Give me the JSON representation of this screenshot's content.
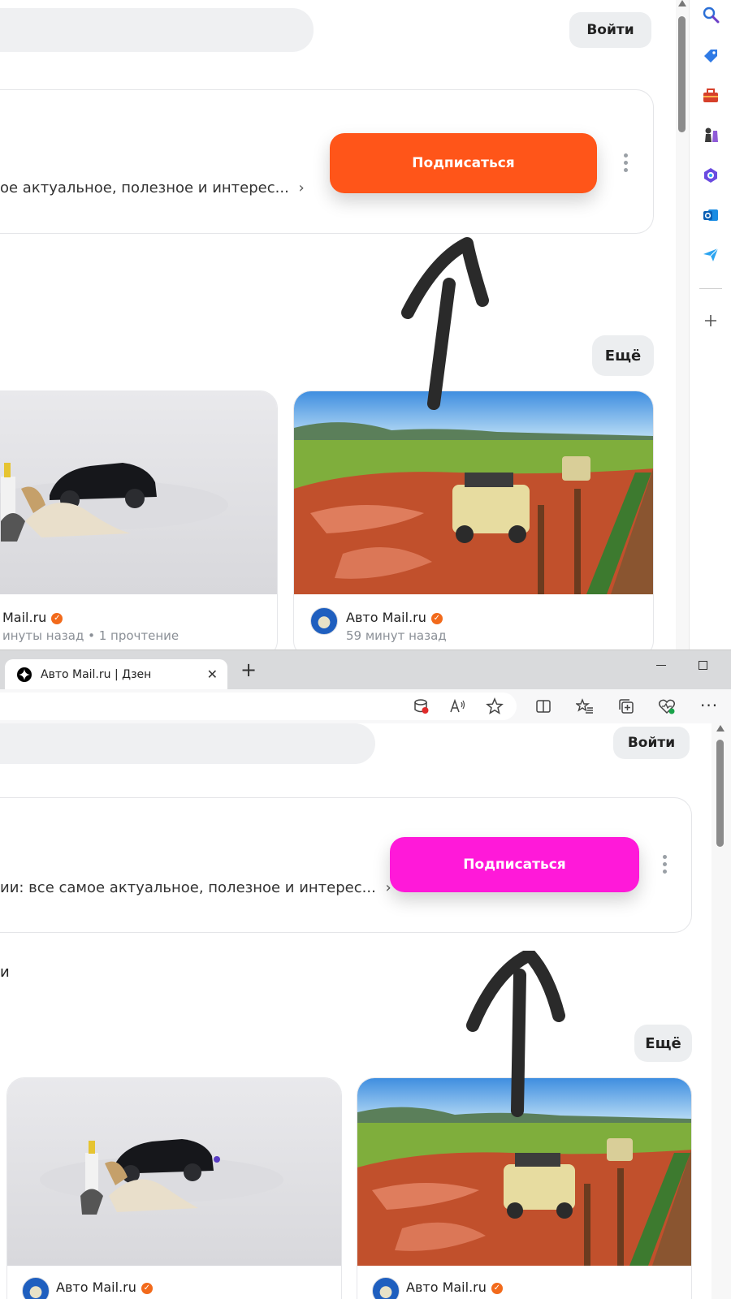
{
  "top": {
    "login_label": "Войти",
    "subscribe_label": "Подписаться",
    "subscribe_color": "#ff5519",
    "description": "ое актуальное, полезное и интерес...",
    "more_label": "Ещё",
    "cards": [
      {
        "author": "Mail.ru",
        "meta": "инуты назад • 1 прочтение"
      },
      {
        "author": "Авто Mail.ru",
        "meta": "59 минут назад"
      }
    ],
    "sidebar_icons": [
      "search-icon",
      "tag-icon",
      "toolbox-icon",
      "chess-icon",
      "copilot-icon",
      "outlook-icon",
      "send-icon",
      "add-icon"
    ]
  },
  "bottom": {
    "tab_title": "Авто Mail.ru | Дзен",
    "new_tab_label": "+",
    "login_label": "Войти",
    "subscribe_label": "Подписаться",
    "subscribe_color": "#ff19d9",
    "description": "ии: все самое актуальное, полезное и интерес...",
    "fragment_text": "и",
    "more_label": "Ещё",
    "cards": [
      {
        "author": "Авто Mail.ru"
      },
      {
        "author": "Авто Mail.ru"
      }
    ],
    "toolbar_icons": [
      "tracking-prevention-icon",
      "read-aloud-icon",
      "favorite-star-icon",
      "split-screen-icon",
      "favorites-icon",
      "collections-icon",
      "browser-essentials-icon",
      "more-icon"
    ]
  },
  "annotation": {
    "arrow_color": "#2a2a2a"
  }
}
